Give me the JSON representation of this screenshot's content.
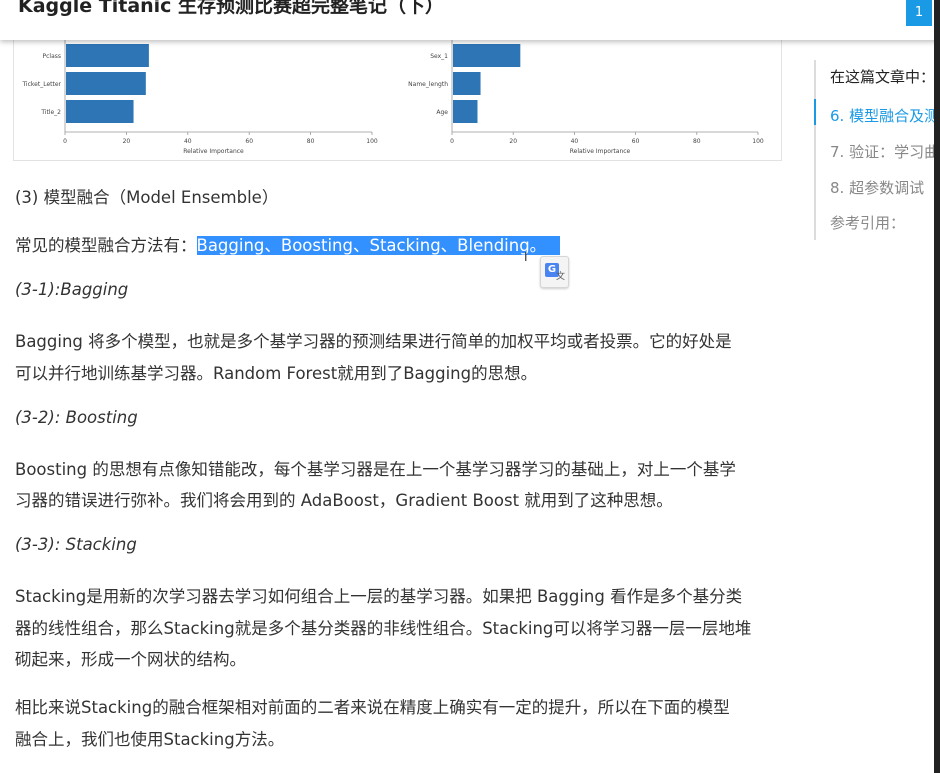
{
  "header": {
    "title": "Kaggle Titanic 生存预测比赛超完整笔记（下）",
    "button_label": "1"
  },
  "chart_data": [
    {
      "type": "bar",
      "orientation": "horizontal",
      "categories": [
        "Pclass",
        "Ticket_Letter",
        "Title_2"
      ],
      "values": [
        27,
        26,
        22
      ],
      "xlabel": "Relative Importance",
      "xticks": [
        "0",
        "20",
        "40",
        "60",
        "80",
        "100"
      ],
      "xlim": [
        0,
        100
      ],
      "color": "#2e75b6"
    },
    {
      "type": "bar",
      "orientation": "horizontal",
      "categories": [
        "Sex_1",
        "Name_length",
        "Age"
      ],
      "values": [
        22,
        9,
        8
      ],
      "xlabel": "Relative Importance",
      "xticks": [
        "0",
        "20",
        "40",
        "60",
        "80",
        "100"
      ],
      "xlim": [
        0,
        100
      ],
      "color": "#2e75b6"
    }
  ],
  "article": {
    "section_title": "(3) 模型融合（Model Ensemble）",
    "methods_prefix": "常见的模型融合方法有：",
    "methods_highlight": "Bagging、Boosting、Stacking、Blending。",
    "sub1_title": "(3-1):Bagging",
    "sub1_line1": "Bagging 将多个模型，也就是多个基学习器的预测结果进行简单的加权平均或者投票。它的好处是",
    "sub1_line2": "可以并行地训练基学习器。Random Forest就用到了Bagging的思想。",
    "sub2_title": "(3-2): Boosting",
    "sub2_line1": "Boosting 的思想有点像知错能改，每个基学习器是在上一个基学习器学习的基础上，对上一个基学",
    "sub2_line2": "习器的错误进行弥补。我们将会用到的 AdaBoost，Gradient Boost 就用到了这种思想。",
    "sub3_title": "(3-3): Stacking",
    "sub3_line1": "Stacking是用新的次学习器去学习如何组合上一层的基学习器。如果把 Bagging 看作是多个基分类",
    "sub3_line2": "器的线性组合，那么Stacking就是多个基分类器的非线性组合。Stacking可以将学习器一层一层地堆",
    "sub3_line3": "砌起来，形成一个网状的结构。",
    "para4_line1": "相比来说Stacking的融合框架相对前面的二者来说在精度上确实有一定的提升，所以在下面的模型",
    "para4_line2": "融合上，我们也使用Stacking方法。"
  },
  "toc": {
    "title": "在这篇文章中：",
    "items": [
      {
        "label": "6. 模型融合及测",
        "active": true
      },
      {
        "label": "7. 验证：学习曲",
        "active": false
      },
      {
        "label": "8. 超参数调试",
        "active": false
      },
      {
        "label": "参考引用：",
        "active": false
      }
    ]
  },
  "translate_icon": {
    "name": "google-translate-icon",
    "letter": "G",
    "sub": "文"
  }
}
